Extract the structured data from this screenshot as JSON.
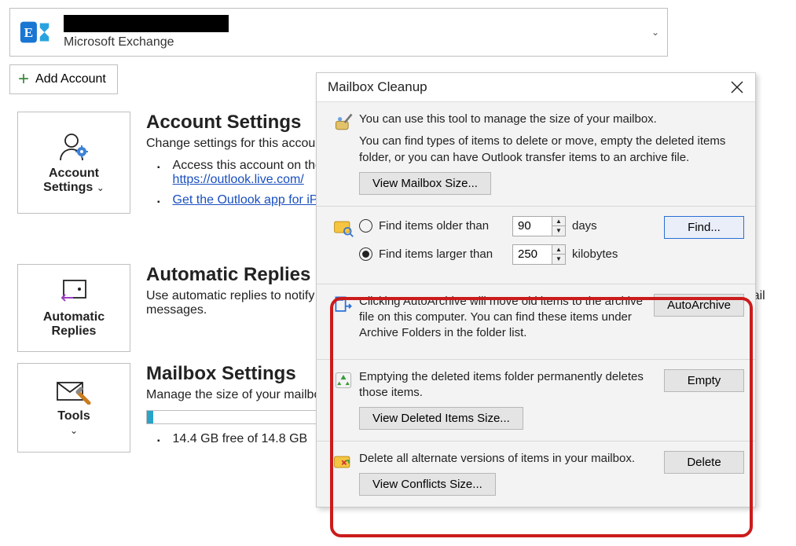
{
  "account": {
    "name_redacted": true,
    "subtitle": "Microsoft Exchange",
    "chevron": "⌄"
  },
  "add_account_label": "Add Account",
  "sections": {
    "account_settings": {
      "tile_line1": "Account",
      "tile_line2": "Settings",
      "title": "Account Settings",
      "desc": "Change settings for this account or set up more connections.",
      "bullets": [
        {
          "text": "Access this account on the web.",
          "link": "https://outlook.live.com/"
        },
        {
          "text_link": "Get the Outlook app for iPhone, iPad, Android."
        }
      ]
    },
    "automatic_replies": {
      "tile_line1": "Automatic",
      "tile_line2": "Replies",
      "title": "Automatic Replies",
      "desc": "Use automatic replies to notify others that you are out of office, on vacation, or not available to respond to email messages."
    },
    "mailbox_settings": {
      "tile_line1": "Tools",
      "title": "Mailbox Settings",
      "desc": "Manage the size of your mailbox by emptying Deleted Items and archiving.",
      "storage_free": "14.4 GB free of 14.8 GB"
    }
  },
  "dialog": {
    "title": "Mailbox Cleanup",
    "intro1": "You can use this tool to manage the size of your mailbox.",
    "intro2": "You can find types of items to delete or move, empty the deleted items folder, or you can have Outlook transfer items to an archive file.",
    "view_mailbox_size": "View Mailbox Size...",
    "find": {
      "older_label": "Find items older than",
      "older_value": "90",
      "older_unit": "days",
      "larger_label": "Find items larger than",
      "larger_value": "250",
      "larger_unit": "kilobytes",
      "selected": "larger",
      "find_btn": "Find..."
    },
    "archive": {
      "text": "Clicking AutoArchive will move old items to the archive file on this computer. You can find these items under Archive Folders in the folder list.",
      "btn": "AutoArchive"
    },
    "deleted": {
      "text": "Emptying the deleted items folder permanently deletes those items.",
      "btn": "Empty",
      "view_btn": "View Deleted Items Size..."
    },
    "conflicts": {
      "text": "Delete all alternate versions of items in your mailbox.",
      "btn": "Delete",
      "view_btn": "View Conflicts Size..."
    }
  }
}
